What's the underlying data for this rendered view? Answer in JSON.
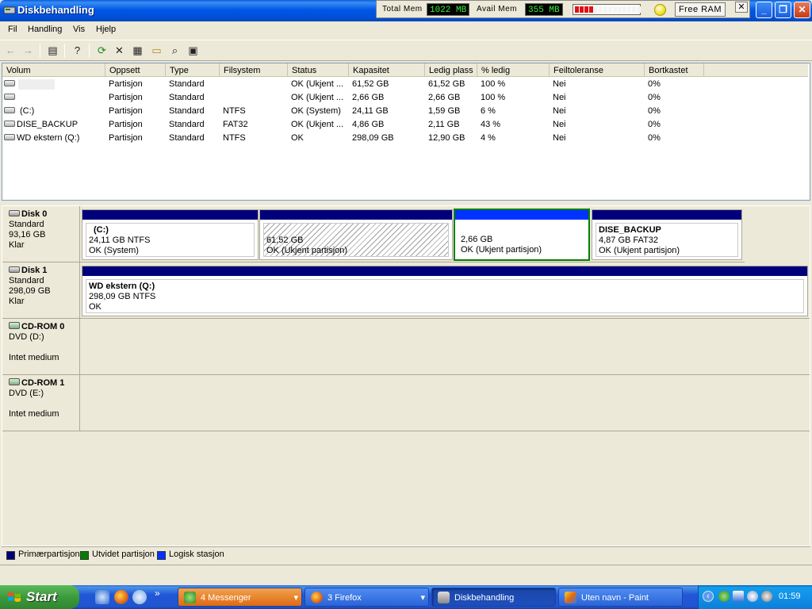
{
  "window": {
    "title": "Diskbehandling",
    "minimize": "_",
    "maximize": "❐",
    "close": "✕"
  },
  "memwidget": {
    "total_label": "Total Mem",
    "total_value": "1022 MB",
    "avail_label": "Avail Mem",
    "avail_value": "355 MB",
    "usage_segments_filled": 4,
    "usage_segments_total": 14,
    "free_ram_label": "Free RAM",
    "close_label": "✕"
  },
  "menu": {
    "file": "Fil",
    "action": "Handling",
    "view": "Vis",
    "help": "Hjelp"
  },
  "toolbar": {
    "back_icon": "←",
    "forward_icon": "→",
    "console_icon": "▤",
    "help_icon": "?",
    "refresh_icon": "⟳",
    "delete_icon": "✕",
    "properties_icon": "▦",
    "open_icon": "▭",
    "search_icon": "⌕",
    "settings_icon": "▣"
  },
  "columns": [
    "Volum",
    "Oppsett",
    "Type",
    "Filsystem",
    "Status",
    "Kapasitet",
    "Ledig plass",
    "% ledig",
    "Feiltoleranse",
    "Bortkastet"
  ],
  "volumes": [
    {
      "volume": "",
      "layout": "Partisjon",
      "type": "Standard",
      "fs": "",
      "status": "OK (Ukjent ...",
      "capacity": "61,52 GB",
      "free": "61,52 GB",
      "pct": "100 %",
      "fault": "Nei",
      "overhead": "0%"
    },
    {
      "volume": "",
      "layout": "Partisjon",
      "type": "Standard",
      "fs": "",
      "status": "OK (Ukjent ...",
      "capacity": "2,66 GB",
      "free": "2,66 GB",
      "pct": "100 %",
      "fault": "Nei",
      "overhead": "0%"
    },
    {
      "volume": "(C:)",
      "layout": "Partisjon",
      "type": "Standard",
      "fs": "NTFS",
      "status": "OK (System)",
      "capacity": "24,11 GB",
      "free": "1,59 GB",
      "pct": "6 %",
      "fault": "Nei",
      "overhead": "0%"
    },
    {
      "volume": "DISE_BACKUP",
      "layout": "Partisjon",
      "type": "Standard",
      "fs": "FAT32",
      "status": "OK (Ukjent ...",
      "capacity": "4,86 GB",
      "free": "2,11 GB",
      "pct": "43 %",
      "fault": "Nei",
      "overhead": "0%"
    },
    {
      "volume": "WD ekstern (Q:)",
      "layout": "Partisjon",
      "type": "Standard",
      "fs": "NTFS",
      "status": "OK",
      "capacity": "298,09 GB",
      "free": "12,90 GB",
      "pct": "4 %",
      "fault": "Nei",
      "overhead": "0%"
    }
  ],
  "disks": [
    {
      "name": "Disk 0",
      "line1": "Standard",
      "line2": "93,16 GB",
      "line3": "Klar"
    },
    {
      "name": "Disk 1",
      "line1": "Standard",
      "line2": "298,09 GB",
      "line3": "Klar"
    },
    {
      "name": "CD-ROM 0",
      "line1": "DVD (D:)",
      "line2": "",
      "line3": "Intet medium"
    },
    {
      "name": "CD-ROM 1",
      "line1": "DVD (E:)",
      "line2": "",
      "line3": "Intet medium"
    }
  ],
  "partitions": {
    "c": {
      "name": "(C:)",
      "size": "24,11 GB NTFS",
      "status": "OK (System)"
    },
    "unknown1": {
      "size": "61,52 GB",
      "status": "OK (Ukjent partisjon)"
    },
    "logical": {
      "size": "2,66 GB",
      "status": "OK (Ukjent partisjon)"
    },
    "dise": {
      "name": "DISE_BACKUP",
      "size": "4,87 GB FAT32",
      "status": "OK (Ukjent partisjon)"
    },
    "wd": {
      "name": "WD ekstern  (Q:)",
      "size": "298,09 GB NTFS",
      "status": "OK"
    }
  },
  "legend": {
    "primary": "Primærpartisjon",
    "extended": "Utvidet partisjon",
    "logical": "Logisk stasjon",
    "colors": {
      "primary": "#00007a",
      "extended": "#008000",
      "logical": "#0033ff"
    }
  },
  "taskbar": {
    "start": "Start",
    "quicklaunch_more": "»",
    "tasks": [
      {
        "label": "4 Messenger",
        "arrow": "▾"
      },
      {
        "label": "3 Firefox",
        "arrow": "▾"
      },
      {
        "label": "Diskbehandling"
      },
      {
        "label": "Uten navn - Paint"
      }
    ],
    "tray_expand": "‹",
    "clock": "01:59"
  }
}
